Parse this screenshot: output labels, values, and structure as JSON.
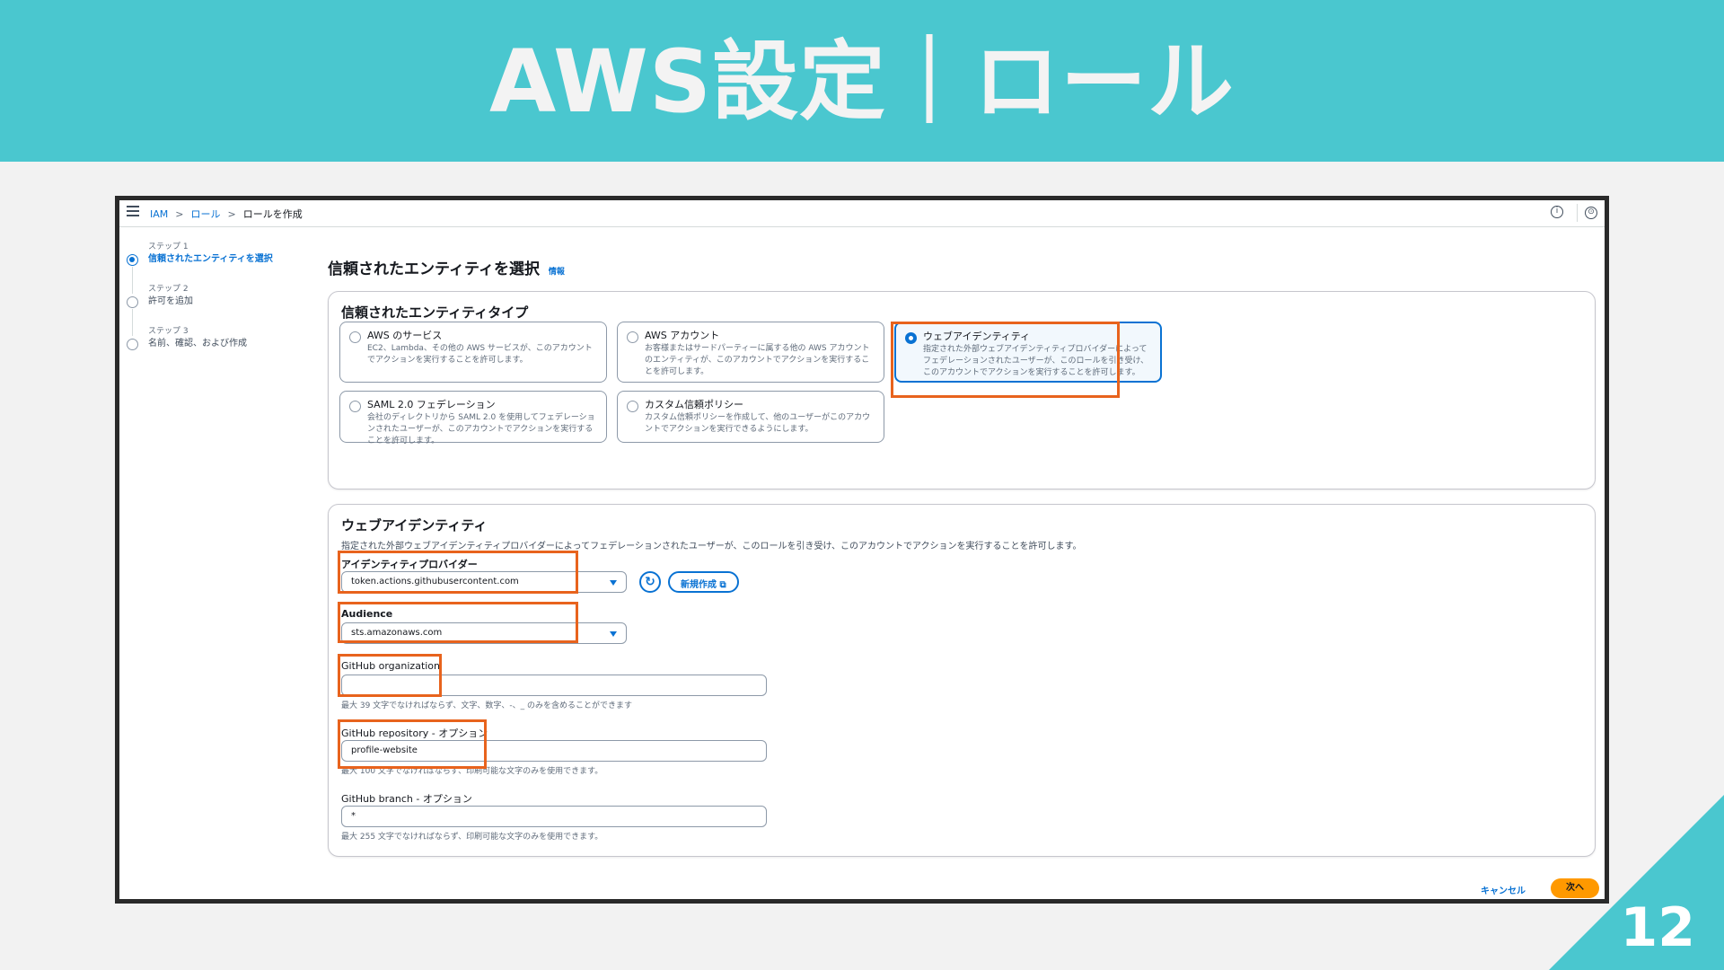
{
  "slide": {
    "title": "AWS設定｜ロール",
    "page_number": "12"
  },
  "topbar": {
    "breadcrumbs": [
      "IAM",
      "ロール",
      "ロールを作成"
    ],
    "separator": ">",
    "info_icon": "i",
    "settings_icon": "⊙"
  },
  "steps": [
    {
      "step": "ステップ 1",
      "label": "信頼されたエンティティを選択"
    },
    {
      "step": "ステップ 2",
      "label": "許可を追加"
    },
    {
      "step": "ステップ 3",
      "label": "名前、確認、および作成"
    }
  ],
  "page": {
    "title": "信頼されたエンティティを選択",
    "info_link": "情報"
  },
  "entity_type": {
    "title": "信頼されたエンティティタイプ",
    "options": [
      {
        "title": "AWS のサービス",
        "desc": "EC2、Lambda、その他の AWS サービスが、このアカウントでアクションを実行することを許可します。"
      },
      {
        "title": "AWS アカウント",
        "desc": "お客様またはサードパーティーに属する他の AWS アカウントのエンティティが、このアカウントでアクションを実行することを許可します。"
      },
      {
        "title": "ウェブアイデンティティ",
        "desc": "指定された外部ウェブアイデンティティプロバイダーによってフェデレーションされたユーザーが、このロールを引き受け、このアカウントでアクションを実行することを許可します。"
      },
      {
        "title": "SAML 2.0 フェデレーション",
        "desc": "会社のディレクトリから SAML 2.0 を使用してフェデレーションされたユーザーが、このアカウントでアクションを実行することを許可します。"
      },
      {
        "title": "カスタム信頼ポリシー",
        "desc": "カスタム信頼ポリシーを作成して、他のユーザーがこのアカウントでアクションを実行できるようにします。"
      }
    ]
  },
  "web_identity": {
    "title": "ウェブアイデンティティ",
    "desc": "指定された外部ウェブアイデンティティプロバイダーによってフェデレーションされたユーザーが、このロールを引き受け、このアカウントでアクションを実行することを許可します。",
    "provider_label": "アイデンティティプロバイダー",
    "provider_value": "token.actions.githubusercontent.com",
    "refresh_icon": "↻",
    "new_button": "新規作成 ⧉",
    "audience_label": "Audience",
    "audience_value": "sts.amazonaws.com",
    "org_label": "GitHub organization",
    "org_value": "",
    "org_hint": "最大 39 文字でなければならず、文字、数字、-、_ のみを含めることができます",
    "repo_label": "GitHub repository - オプション",
    "repo_value": "profile-website",
    "repo_hint": "最大 100 文字でなければならず、印刷可能な文字のみを使用できます。",
    "branch_label": "GitHub branch - オプション",
    "branch_value": "*",
    "branch_hint": "最大 255 文字でなければならず、印刷可能な文字のみを使用できます。"
  },
  "footer": {
    "cancel": "キャンセル",
    "next": "次へ"
  },
  "colors": {
    "banner": "#4ac7cf",
    "highlight": "#e8631d",
    "link": "#0972d3",
    "primary_button": "#ff9900"
  }
}
